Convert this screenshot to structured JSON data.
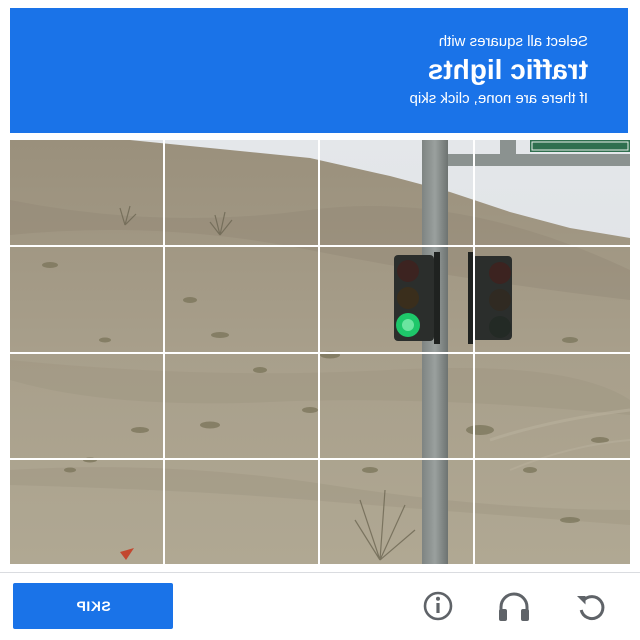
{
  "header": {
    "instruction_line": "Select all squares with",
    "target_object": "traffic lights",
    "skip_hint": "If there are none, click skip",
    "background_color": "#1a73e8",
    "text_mirrored": true
  },
  "grid": {
    "rows": 4,
    "columns": 4,
    "image_description_icon": "traffic-light-scene"
  },
  "footer": {
    "skip_label": "SKIP",
    "icons": [
      "reload-icon",
      "audio-challenge-icon",
      "info-icon"
    ]
  },
  "colors": {
    "accent": "#1a73e8",
    "icon_gray": "#5f6368",
    "traffic_light_green": "#1ec76a"
  }
}
